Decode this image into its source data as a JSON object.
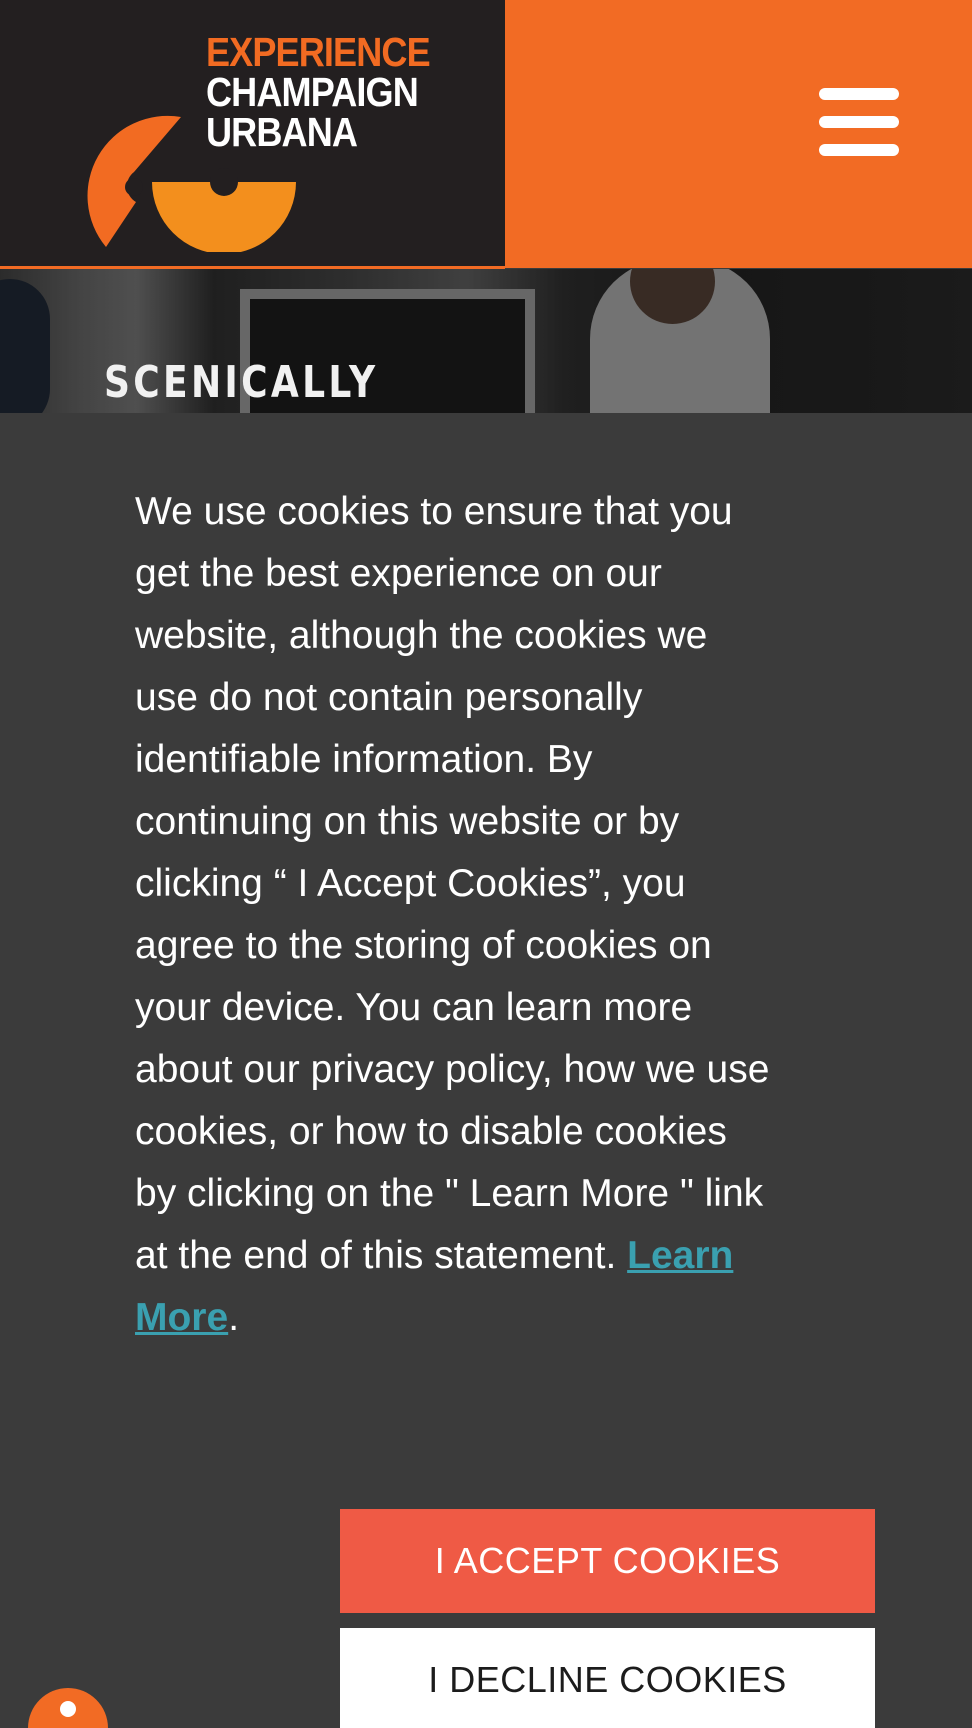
{
  "header": {
    "logo": {
      "line1": "EXPERIENCE",
      "line2": "CHAMPAIGN",
      "line3": "URBANA",
      "icon": "experience-cu-logo-mark"
    },
    "menu_icon": "hamburger-menu-icon"
  },
  "hero": {
    "title": "SCENICALLY"
  },
  "cookie_banner": {
    "message": "We use cookies to ensure that you get the best experience on our website, although the cookies we use do not contain personally identifiable information. By continuing on this website or by clicking “ I Accept Cookies”, you agree to the storing of cookies on your device. You can learn more about our privacy policy, how we use cookies, or how to disable cookies by clicking on the \" Learn More \" link at the end of this statement.",
    "link_label": "Learn More",
    "trailing_punctuation": ".",
    "accept_label": "I ACCEPT COOKIES",
    "decline_label": "I DECLINE COOKIES"
  },
  "accessibility": {
    "icon": "accessibility-person-icon"
  },
  "colors": {
    "brand_orange": "#f26b24",
    "header_dark": "#231f20",
    "banner_bg": "#3b3b3b",
    "accept_button": "#ef5a45",
    "link": "#3aa0b0"
  }
}
